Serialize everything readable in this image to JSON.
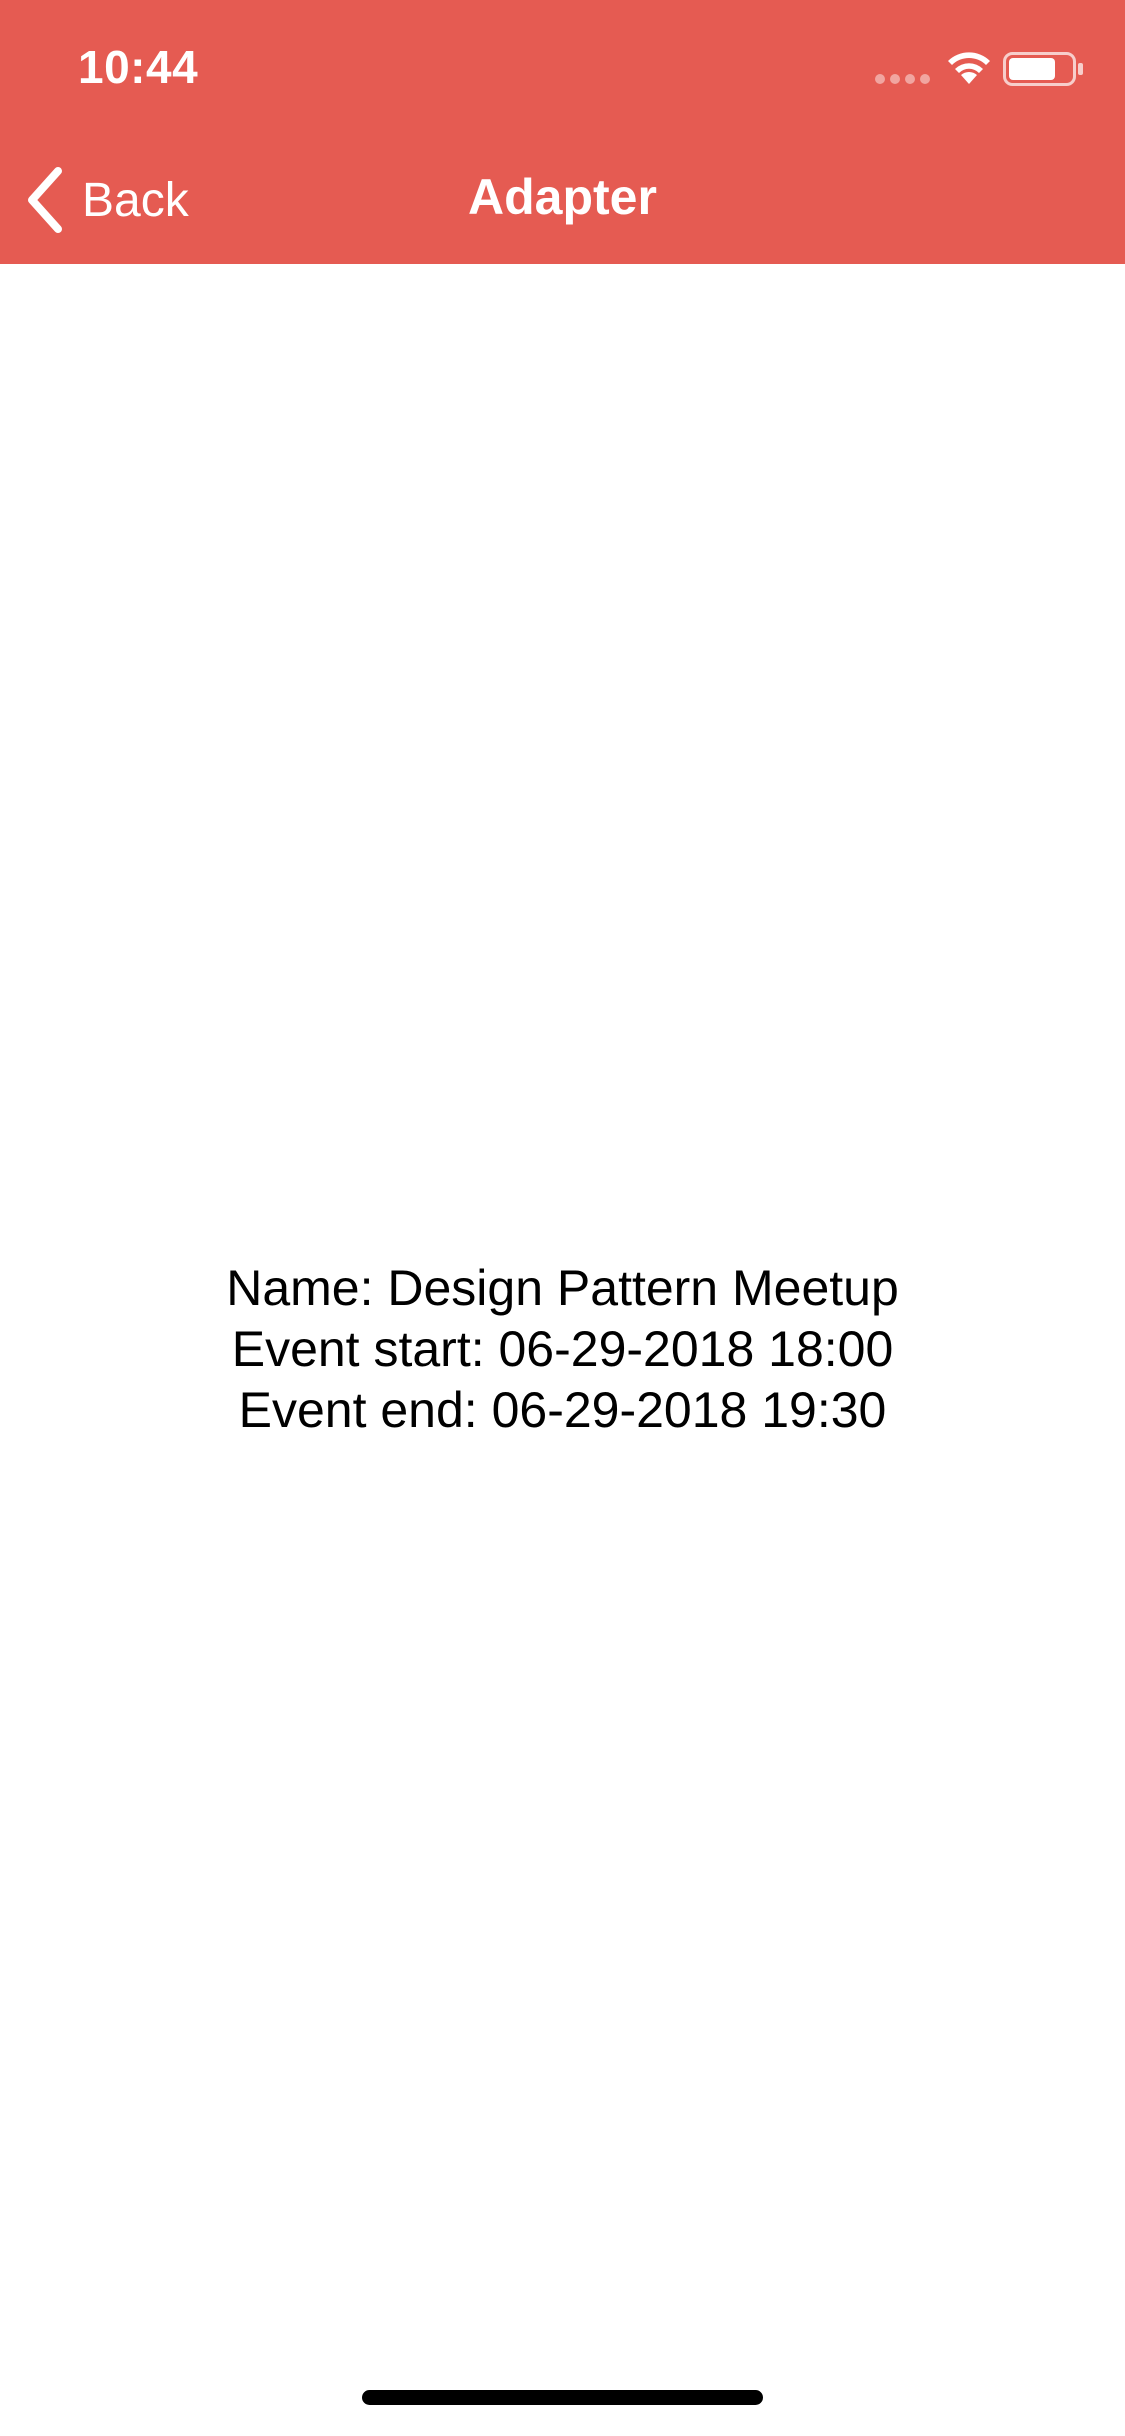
{
  "status_bar": {
    "time": "10:44",
    "wifi_icon": "wifi-icon",
    "battery_icon": "battery-icon",
    "signal_icon": "signal-dots-icon"
  },
  "nav_bar": {
    "back_label": "Back",
    "back_icon": "chevron-left-icon",
    "title": "Adapter",
    "background_color": "#E55B52"
  },
  "event": {
    "name_line": "Name: Design Pattern Meetup",
    "start_line": "Event start: 06-29-2018 18:00",
    "end_line": "Event end: 06-29-2018 19:30"
  }
}
